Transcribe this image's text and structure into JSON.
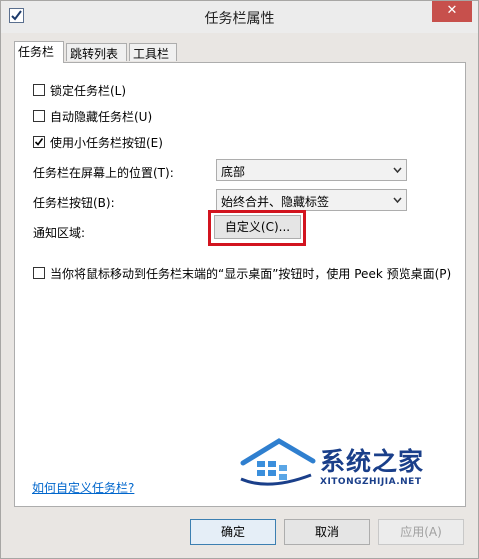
{
  "window": {
    "title": "任务栏属性"
  },
  "tabs": [
    "任务栏",
    "跳转列表",
    "工具栏"
  ],
  "options": {
    "lock_taskbar": {
      "label": "锁定任务栏(L)",
      "checked": false
    },
    "auto_hide": {
      "label": "自动隐藏任务栏(U)",
      "checked": false
    },
    "small_buttons": {
      "label": "使用小任务栏按钮(E)",
      "checked": true
    }
  },
  "location": {
    "label": "任务栏在屏幕上的位置(T):",
    "value": "底部"
  },
  "buttons_combine": {
    "label": "任务栏按钮(B):",
    "value": "始终合并、隐藏标签"
  },
  "notification": {
    "label": "通知区域:",
    "button": "自定义(C)..."
  },
  "peek": {
    "label": "当你将鼠标移动到任务栏末端的“显示桌面”按钮时，使用 Peek 预览桌面(P)",
    "checked": false
  },
  "help_link": "如何自定义任务栏?",
  "watermark": {
    "title": "系统之家",
    "url": "XITONGZHIJIA.NET"
  },
  "footer": {
    "ok": "确定",
    "cancel": "取消",
    "apply": "应用(A)"
  },
  "colors": {
    "highlight_box": "#d2141f",
    "link": "#0066cc",
    "close_button": "#c7504c"
  }
}
